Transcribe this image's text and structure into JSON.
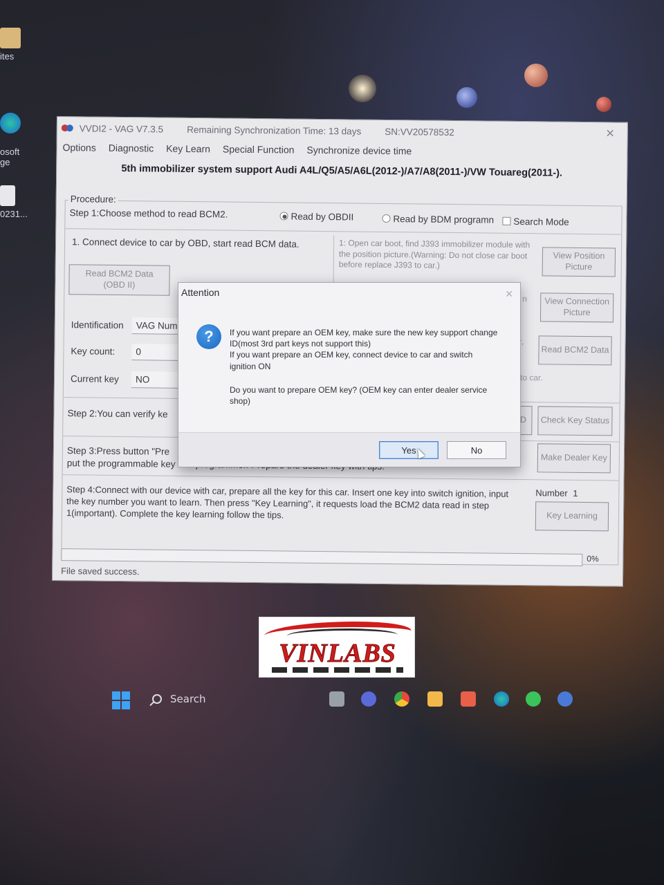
{
  "desktop": {
    "icons": [
      {
        "label": "ites"
      },
      {
        "label": "osoft\nge"
      },
      {
        "label": "0231..."
      }
    ]
  },
  "window": {
    "title": "VVDI2 - VAG V7.3.5",
    "sync_time": "Remaining Synchronization Time: 13 days",
    "serial": "SN:VV20578532",
    "menu": [
      "Options",
      "Diagnostic",
      "Key Learn",
      "Special Function",
      "Synchronize device time"
    ],
    "headline": "5th immobilizer system support Audi A4L/Q5/A5/A6L(2012-)/A7/A8(2011-)/VW Touareg(2011-).",
    "procedure_label": "Procedure:",
    "step1": {
      "text": "Step 1:Choose method to read BCM2.",
      "option_obd": "Read by OBDII",
      "option_bdm": "Read by BDM programn",
      "search_mode": "Search Mode"
    },
    "obd_section": {
      "instruction": "1. Connect device to car by OBD, start read BCM data.",
      "read_button": "Read BCM2 Data\n(OBD II)"
    },
    "bdm_section": {
      "instruction": "1: Open car boot, find J393 immobilizer module with the position picture.(Warning: Do not close car boot before replace J393 to car.)",
      "view_position": "View Position\nPicture",
      "view_connection": "View Connection\nPicture",
      "read_bcm2": "Read BCM2 Data",
      "suffix_1": "n",
      "suffix_2": "r,",
      "suffix_3": "to car."
    },
    "fields": {
      "identification_label": "Identification",
      "identification_value": "VAG Num",
      "key_count_label": "Key count:",
      "key_count_value": "0",
      "current_key_label": "Current key",
      "current_key_value": "NO"
    },
    "step2": {
      "text": "Step 2:You can verify ke",
      "button_partial": "D",
      "check_key_status": "Check Key Status"
    },
    "step3": {
      "text_line1": "Step 3:Press button \"Pre",
      "text_line2": "put the programmable key into programmer. Prepare the dealer key with tips.",
      "make_dealer_key": "Make Dealer Key"
    },
    "step4": {
      "text": "Step 4:Connect with our device with car, prepare all the key for this car. Insert one key into switch ignition, input the key number you want to learn. Then press \"Key Learning\",  it requests load the BCM2 data read in step 1(important). Complete the key learning follow the tips.",
      "number_label": "Number",
      "number_value": "1",
      "key_learning": "Key Learning"
    },
    "progress_percent": "0%",
    "progress_value": 0,
    "status": "File saved success."
  },
  "dialog": {
    "title": "Attention",
    "line1": "If you want prepare an OEM key, make sure the new key support change ID(most 3rd part keys not support this)",
    "line2": "If you want prepare an OEM key, connect device to car and switch ignition ON",
    "line3": "Do you want to prepare OEM key? (OEM key can enter dealer service shop)",
    "yes": "Yes",
    "no": "No",
    "close_glyph": "✕"
  },
  "logo": {
    "text": "VINLABS",
    "brand_color": "#d01c1c"
  },
  "taskbar": {
    "search_label": "Search"
  },
  "colors": {
    "accent_blue": "#1b6ac2",
    "window_bg": "#e9e9ec",
    "default_button": "#4a86d0"
  }
}
